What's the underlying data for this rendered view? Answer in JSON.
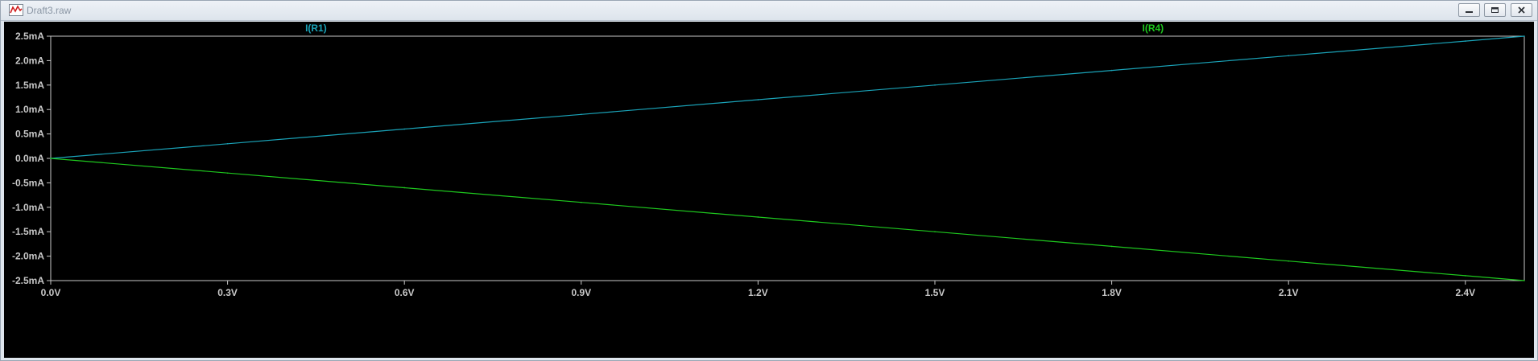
{
  "window": {
    "title": "Draft3.raw",
    "controls": {
      "minimize_icon": "minimize-icon",
      "restore_icon": "restore-icon",
      "close_icon": "close-icon"
    }
  },
  "colors": {
    "background": "#000000",
    "axis": "#c8c8c8",
    "series_r1": "#1aa3b8",
    "series_r4": "#1ec81e"
  },
  "chart_data": {
    "type": "line",
    "title": "",
    "xlabel": "",
    "ylabel": "",
    "xlim": [
      0,
      2.5
    ],
    "ylim": [
      -2.5,
      2.5
    ],
    "grid": false,
    "x_ticks": [
      {
        "value": 0.0,
        "label": "0.0V"
      },
      {
        "value": 0.3,
        "label": "0.3V"
      },
      {
        "value": 0.6,
        "label": "0.6V"
      },
      {
        "value": 0.9,
        "label": "0.9V"
      },
      {
        "value": 1.2,
        "label": "1.2V"
      },
      {
        "value": 1.5,
        "label": "1.5V"
      },
      {
        "value": 1.8,
        "label": "1.8V"
      },
      {
        "value": 2.1,
        "label": "2.1V"
      },
      {
        "value": 2.4,
        "label": "2.4V"
      }
    ],
    "y_ticks": [
      {
        "value": 2.5,
        "label": "2.5mA"
      },
      {
        "value": 2.0,
        "label": "2.0mA"
      },
      {
        "value": 1.5,
        "label": "1.5mA"
      },
      {
        "value": 1.0,
        "label": "1.0mA"
      },
      {
        "value": 0.5,
        "label": "0.5mA"
      },
      {
        "value": 0.0,
        "label": "0.0mA"
      },
      {
        "value": -0.5,
        "label": "-0.5mA"
      },
      {
        "value": -1.0,
        "label": "-1.0mA"
      },
      {
        "value": -1.5,
        "label": "-1.5mA"
      },
      {
        "value": -2.0,
        "label": "-2.0mA"
      },
      {
        "value": -2.5,
        "label": "-2.5mA"
      }
    ],
    "series": [
      {
        "name": "I(R1)",
        "color": "#1aa3b8",
        "x": [
          0.0,
          0.3,
          0.6,
          0.9,
          1.2,
          1.5,
          1.8,
          2.1,
          2.4,
          2.5
        ],
        "y": [
          0.0,
          0.3,
          0.6,
          0.9,
          1.2,
          1.5,
          1.8,
          2.1,
          2.4,
          2.5
        ]
      },
      {
        "name": "I(R4)",
        "color": "#1ec81e",
        "x": [
          0.0,
          0.3,
          0.6,
          0.9,
          1.2,
          1.5,
          1.8,
          2.1,
          2.4,
          2.5
        ],
        "y": [
          0.0,
          -0.3,
          -0.6,
          -0.9,
          -1.2,
          -1.5,
          -1.8,
          -2.1,
          -2.4,
          -2.5
        ]
      }
    ]
  }
}
